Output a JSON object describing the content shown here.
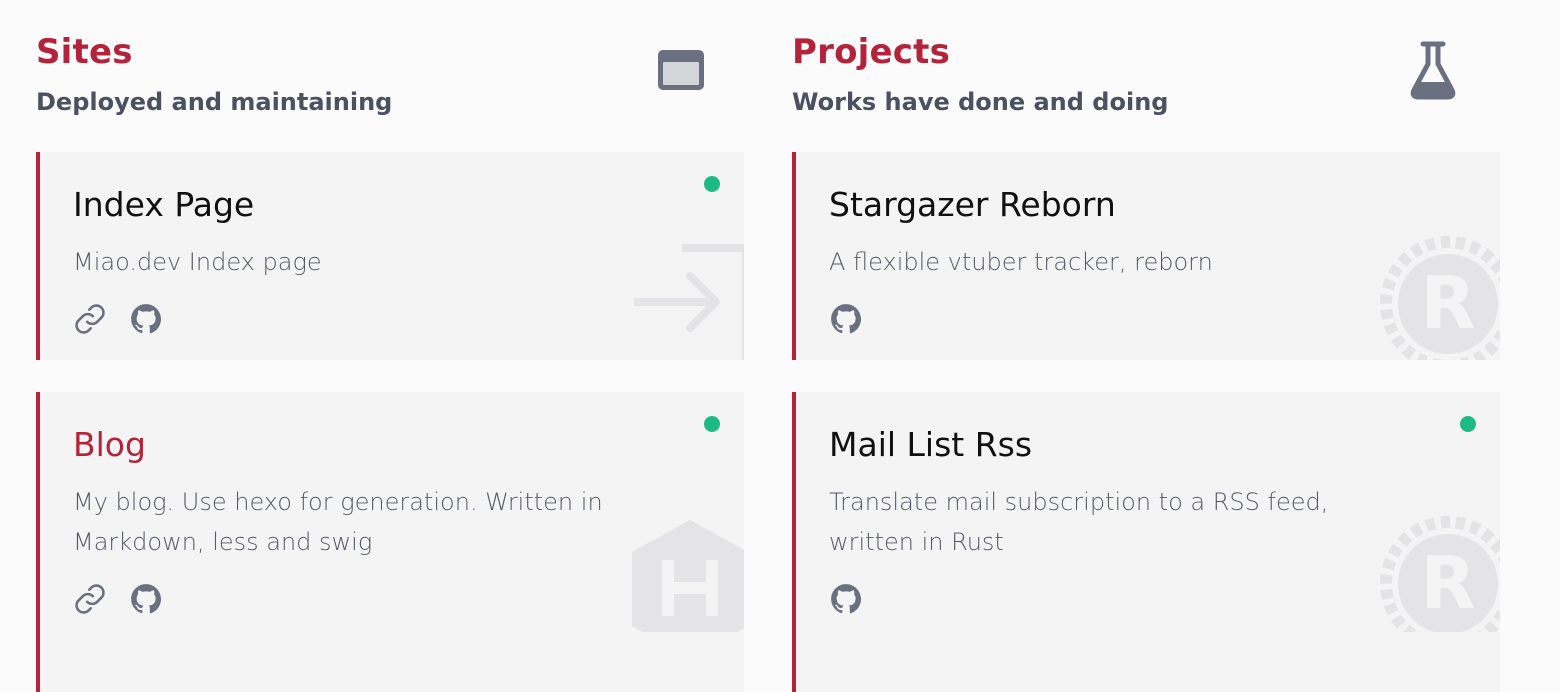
{
  "sites": {
    "title": "Sites",
    "subtitle": "Deployed and maintaining",
    "icon": "browser-window-icon",
    "cards": [
      {
        "title": "Index Page",
        "description": "Miao.dev Index page",
        "online": true,
        "links": [
          "link-icon",
          "github-icon"
        ],
        "background_icon": "sign-in-arrow-icon"
      },
      {
        "title": "Blog",
        "description": "My blog. Use hexo for generation. Written in Markdown, less and swig",
        "online": true,
        "links": [
          "link-icon",
          "github-icon"
        ],
        "background_icon": "hexo-logo-icon"
      }
    ]
  },
  "projects": {
    "title": "Projects",
    "subtitle": "Works have done and doing",
    "icon": "flask-icon",
    "cards": [
      {
        "title": "Stargazer Reborn",
        "description": "A flexible vtuber tracker, reborn",
        "online": false,
        "links": [
          "github-icon"
        ],
        "background_icon": "rust-logo-icon"
      },
      {
        "title": "Mail List Rss",
        "description": "Translate mail subscription to a RSS feed, written in Rust",
        "online": true,
        "links": [
          "github-icon"
        ],
        "background_icon": "rust-logo-icon"
      }
    ]
  },
  "colors": {
    "accent": "#b3243b",
    "status_online": "#1dba85",
    "card_background": "#f4f4f5",
    "muted_text": "#555a66"
  }
}
